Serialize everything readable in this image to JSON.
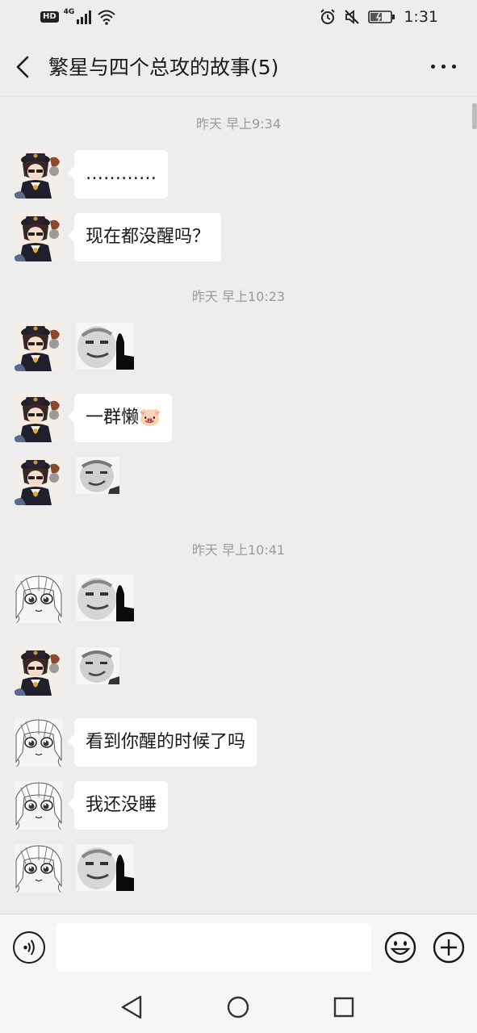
{
  "status_bar": {
    "network_badge": "HD",
    "network_type": "4G",
    "time": "1:31",
    "icons": [
      "signal-icon",
      "wifi-icon",
      "alarm-icon",
      "mute-icon",
      "battery-icon"
    ]
  },
  "header": {
    "title": "繁星与四个总攻的故事(5)",
    "back_icon": "back-arrow-icon",
    "more_icon": "more-icon"
  },
  "timestamps": {
    "t1": "昨天 早上9:34",
    "t2": "昨天 早上10:23",
    "t3": "昨天 早上10:41"
  },
  "messages": [
    {
      "sender": "user-a",
      "type": "text",
      "text": "…………"
    },
    {
      "sender": "user-a",
      "type": "text",
      "text": "现在都没醒吗？"
    },
    {
      "sender": "user-a",
      "type": "sticker",
      "sticker": "meme-face-finger"
    },
    {
      "sender": "user-a",
      "type": "text",
      "text": "一群懒🐷"
    },
    {
      "sender": "user-a",
      "type": "sticker",
      "sticker": "meme-face-small"
    },
    {
      "sender": "user-b",
      "type": "sticker",
      "sticker": "meme-face-finger"
    },
    {
      "sender": "user-a",
      "type": "sticker",
      "sticker": "meme-face-small"
    },
    {
      "sender": "user-b",
      "type": "text",
      "text": "看到你醒的时候了吗"
    },
    {
      "sender": "user-b",
      "type": "text",
      "text": "我还没睡"
    },
    {
      "sender": "user-b",
      "type": "sticker",
      "sticker": "meme-face-finger"
    }
  ],
  "input_bar": {
    "voice_icon": "voice-icon",
    "input_value": "",
    "emoji_icon": "emoji-icon",
    "plus_icon": "plus-icon"
  },
  "nav_bar": {
    "icons": [
      "nav-back-icon",
      "nav-home-icon",
      "nav-recent-icon"
    ]
  },
  "colors": {
    "background": "#ededed",
    "bubble": "#ffffff",
    "timestamp": "#9b9b9b"
  }
}
